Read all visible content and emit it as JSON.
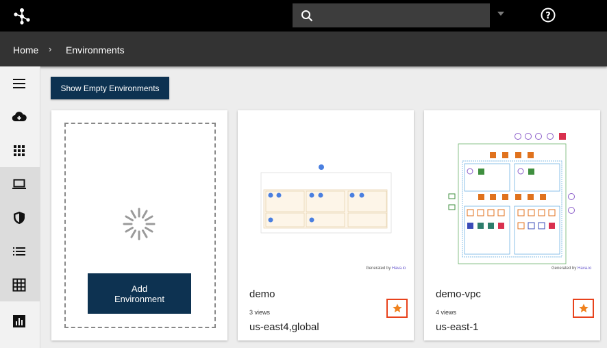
{
  "header": {
    "search": {
      "placeholder": "",
      "value": ""
    }
  },
  "breadcrumb": {
    "home": "Home",
    "separator": "›",
    "current": "Environments"
  },
  "sidebar": {
    "items": [
      {
        "icon": "menu-icon"
      },
      {
        "icon": "cloud-download-icon"
      },
      {
        "icon": "apps-grid-icon"
      },
      {
        "icon": "laptop-icon",
        "active": true
      },
      {
        "icon": "shield-icon",
        "active": true
      },
      {
        "icon": "list-icon",
        "active": true
      },
      {
        "icon": "table-grid-icon",
        "active": true
      },
      {
        "icon": "bar-chart-icon"
      }
    ]
  },
  "toolbar": {
    "show_empty_label": "Show Empty Environments"
  },
  "add_card": {
    "button_label": "Add\nEnvironment"
  },
  "environments": [
    {
      "name": "demo",
      "views": "3 views",
      "region": "us-east4,global",
      "generated_by": "Generated by",
      "generator": "Hava.io",
      "starred": true
    },
    {
      "name": "demo-vpc",
      "views": "4 views",
      "region": "us-east-1",
      "generated_by": "Generated by",
      "generator": "Hava.io",
      "starred": true
    }
  ],
  "colors": {
    "topbar": "#000000",
    "breadcrumb_bar": "#333333",
    "primary_button": "#0d3251",
    "star_border": "#e8421c",
    "star": "#f0821e"
  }
}
